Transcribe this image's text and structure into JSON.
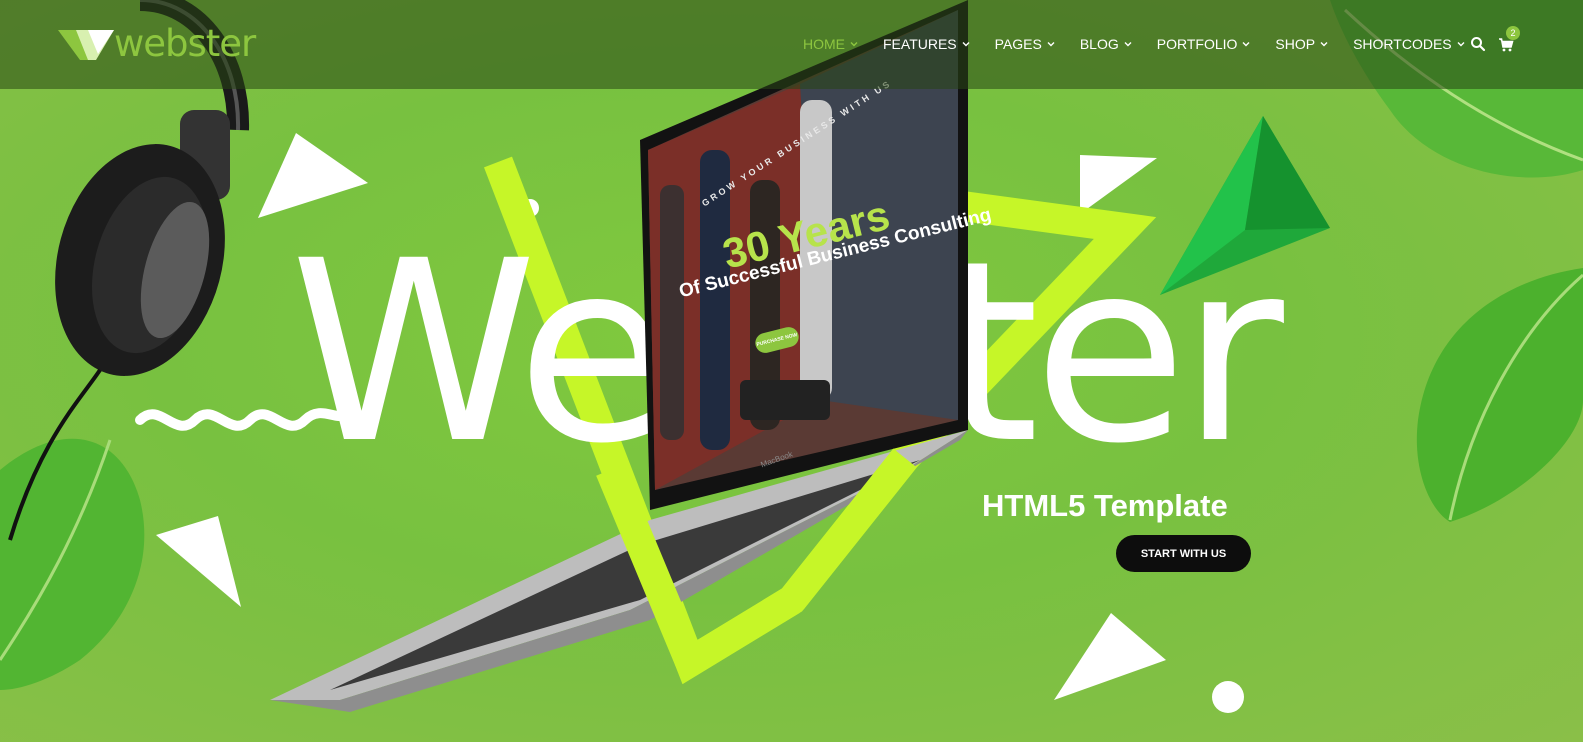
{
  "brand": {
    "name": "webster",
    "accent_color": "#8dc63f"
  },
  "nav": {
    "items": [
      {
        "label": "HOME",
        "active": true
      },
      {
        "label": "FEATURES",
        "active": false
      },
      {
        "label": "PAGES",
        "active": false
      },
      {
        "label": "BLOG",
        "active": false
      },
      {
        "label": "PORTFOLIO",
        "active": false
      },
      {
        "label": "SHOP",
        "active": false
      },
      {
        "label": "SHORTCODES",
        "active": false
      }
    ],
    "search_icon": "search-icon",
    "cart_icon": "cart-icon",
    "cart_count": "2"
  },
  "hero": {
    "title": "Webster",
    "subtitle": "HTML5 Template",
    "cta_label": "START WITH US",
    "background_color": "#7ac142",
    "laptop_screen": {
      "kicker": "GROW YOUR BUSINESS WITH US",
      "headline": "30 Years",
      "subheadline": "Of Successful Business Consulting",
      "button": "PURCHASE NOW",
      "brand_label": "MacBook"
    }
  }
}
